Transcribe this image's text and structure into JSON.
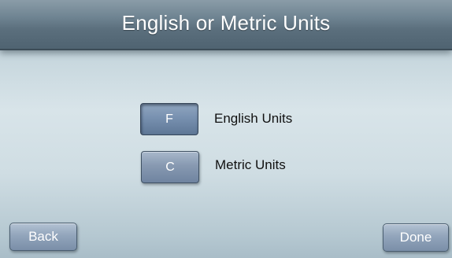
{
  "header": {
    "title": "English or Metric Units"
  },
  "units": {
    "options": [
      {
        "button_label": "F",
        "label": "English Units",
        "selected": true
      },
      {
        "button_label": "C",
        "label": "Metric Units",
        "selected": false
      }
    ]
  },
  "footer": {
    "back_label": "Back",
    "done_label": "Done"
  },
  "colors": {
    "header_bg": "#5b6f7d",
    "button_blue": "#7f92ad",
    "background": "#d8e4e9"
  }
}
